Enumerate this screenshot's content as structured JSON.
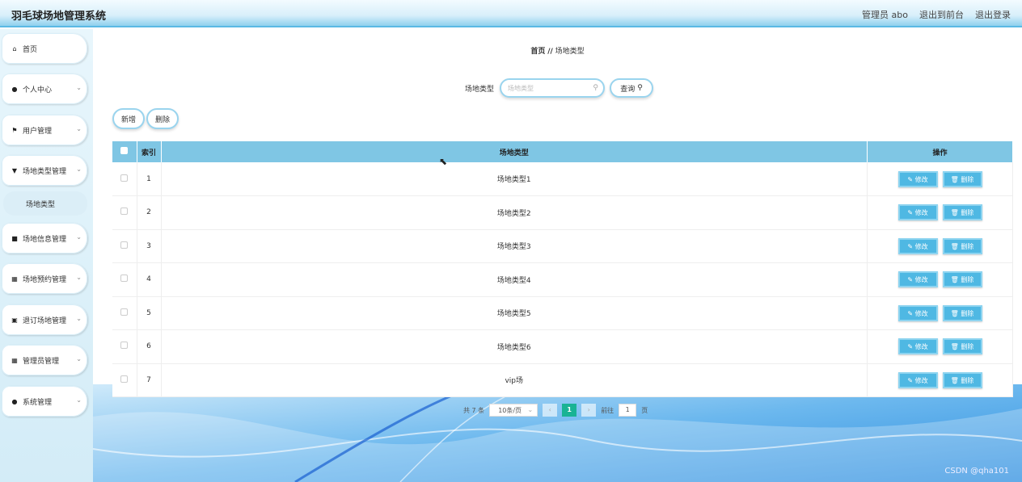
{
  "header": {
    "app_title": "羽毛球场地管理系统",
    "admin_label": "管理员 abo",
    "front_link": "退出到前台",
    "logout_link": "退出登录"
  },
  "sidebar": {
    "items": [
      {
        "label": "首页",
        "icon": "home-icon"
      },
      {
        "label": "个人中心",
        "icon": "user-icon"
      },
      {
        "label": "用户管理",
        "icon": "flag-icon"
      },
      {
        "label": "场地类型管理",
        "icon": "trophy-icon"
      },
      {
        "label": "场地信息管理",
        "icon": "checkbox-icon"
      },
      {
        "label": "场地预约管理",
        "icon": "grid-icon"
      },
      {
        "label": "退订场地管理",
        "icon": "lock-icon"
      },
      {
        "label": "管理员管理",
        "icon": "grid-icon"
      },
      {
        "label": "系统管理",
        "icon": "user-icon"
      }
    ],
    "sub_item": "场地类型"
  },
  "breadcrumb": {
    "home": "首页",
    "sep": "//",
    "current": "场地类型"
  },
  "search": {
    "label": "场地类型",
    "placeholder": "场地类型",
    "button": "查询"
  },
  "actions": {
    "add": "新增",
    "delete": "删除"
  },
  "table": {
    "headers": {
      "index": "索引",
      "type": "场地类型",
      "op": "操作"
    },
    "rows": [
      {
        "index": "1",
        "type": "场地类型1"
      },
      {
        "index": "2",
        "type": "场地类型2"
      },
      {
        "index": "3",
        "type": "场地类型3"
      },
      {
        "index": "4",
        "type": "场地类型4"
      },
      {
        "index": "5",
        "type": "场地类型5"
      },
      {
        "index": "6",
        "type": "场地类型6"
      },
      {
        "index": "7",
        "type": "vip场"
      }
    ],
    "edit_label": "修改",
    "delete_label": "删除"
  },
  "pagination": {
    "total": "共 7 条",
    "page_size": "10条/页",
    "current_page": "1",
    "goto_prefix": "前往",
    "goto_value": "1",
    "goto_suffix": "页"
  },
  "watermark": "CSDN @qha101",
  "colors": {
    "accent": "#4fb8e3",
    "header_row": "#7fc6e4",
    "active_page": "#19b394"
  }
}
